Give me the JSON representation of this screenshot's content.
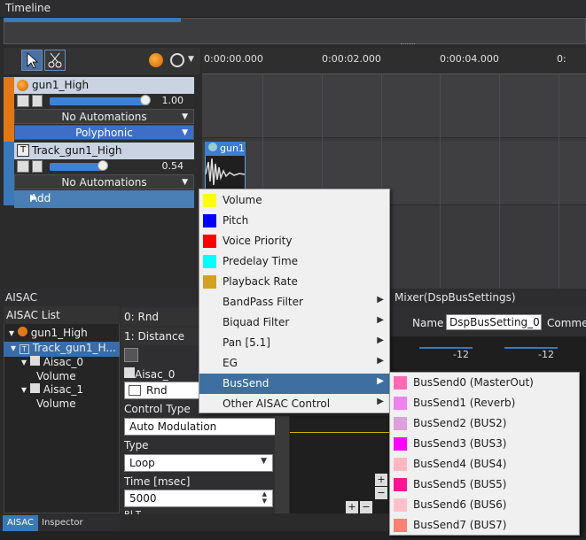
{
  "timeline": {
    "title": "Timeline"
  },
  "ruler": {
    "ticks": [
      "0:00:00.000",
      "0:00:02.000",
      "0:00:04.000"
    ]
  },
  "cue": {
    "name": "gun1_High",
    "volume": "1.00",
    "automation": "No Automations",
    "mode": "Polyphonic",
    "volume_level": 1.0
  },
  "track": {
    "name": "Track_gun1_High",
    "volume": "0.54",
    "automation": "No Automations",
    "add_label": "Add",
    "volume_level": 0.54
  },
  "waveform": {
    "label": "gun1"
  },
  "context_menu": {
    "items": [
      {
        "label": "Volume",
        "color": "#ffff00"
      },
      {
        "label": "Pitch",
        "color": "#0000ff"
      },
      {
        "label": "Voice Priority",
        "color": "#ff0000"
      },
      {
        "label": "Predelay Time",
        "color": "#00ffff"
      },
      {
        "label": "Playback Rate",
        "color": "#d4a020"
      },
      {
        "label": "BandPass Filter",
        "submenu": true
      },
      {
        "label": "Biquad Filter",
        "submenu": true
      },
      {
        "label": "Pan [5.1]",
        "submenu": true
      },
      {
        "label": "EG",
        "submenu": true
      },
      {
        "label": "BusSend",
        "submenu": true,
        "highlighted": true
      },
      {
        "label": "Other AISAC Control",
        "submenu": true
      }
    ]
  },
  "bussend_submenu": {
    "items": [
      {
        "label": "BusSend0 (MasterOut)",
        "color": "#ff69b4"
      },
      {
        "label": "BusSend1 (Reverb)",
        "color": "#ee82ee"
      },
      {
        "label": "BusSend2 (BUS2)",
        "color": "#dda0dd"
      },
      {
        "label": "BusSend3 (BUS3)",
        "color": "#ff00ff"
      },
      {
        "label": "BusSend4 (BUS4)",
        "color": "#ffb6c1"
      },
      {
        "label": "BusSend5 (BUS5)",
        "color": "#ff1493"
      },
      {
        "label": "BusSend6 (BUS6)",
        "color": "#ffc0cb"
      },
      {
        "label": "BusSend7 (BUS7)",
        "color": "#fa8072"
      }
    ]
  },
  "aisac": {
    "title": "AISAC",
    "list_header": "AISAC List",
    "tree": [
      "gun1_High",
      "Track_gun1_H...",
      "Aisac_0",
      "Volume",
      "Aisac_1",
      "Volume"
    ],
    "rows": [
      "0: Rnd",
      "1: Distance"
    ],
    "aisac_name": "Aisac_0",
    "rnd_label": "Rnd",
    "control_type_label": "Control Type",
    "control_type_value": "Auto Modulation",
    "type_label": "Type",
    "type_value": "Loop",
    "time_label": "Time [msec]",
    "time_value": "5000",
    "partial_label": "Rl     T"
  },
  "mixer": {
    "title": "Mixer(DspBusSettings)",
    "name_label": "Name",
    "name_value": "DspBusSetting_0",
    "comment_label": "Commen",
    "level_a": "-12",
    "level_b": "-12"
  },
  "tabs": [
    "AISAC",
    "Inspector"
  ]
}
